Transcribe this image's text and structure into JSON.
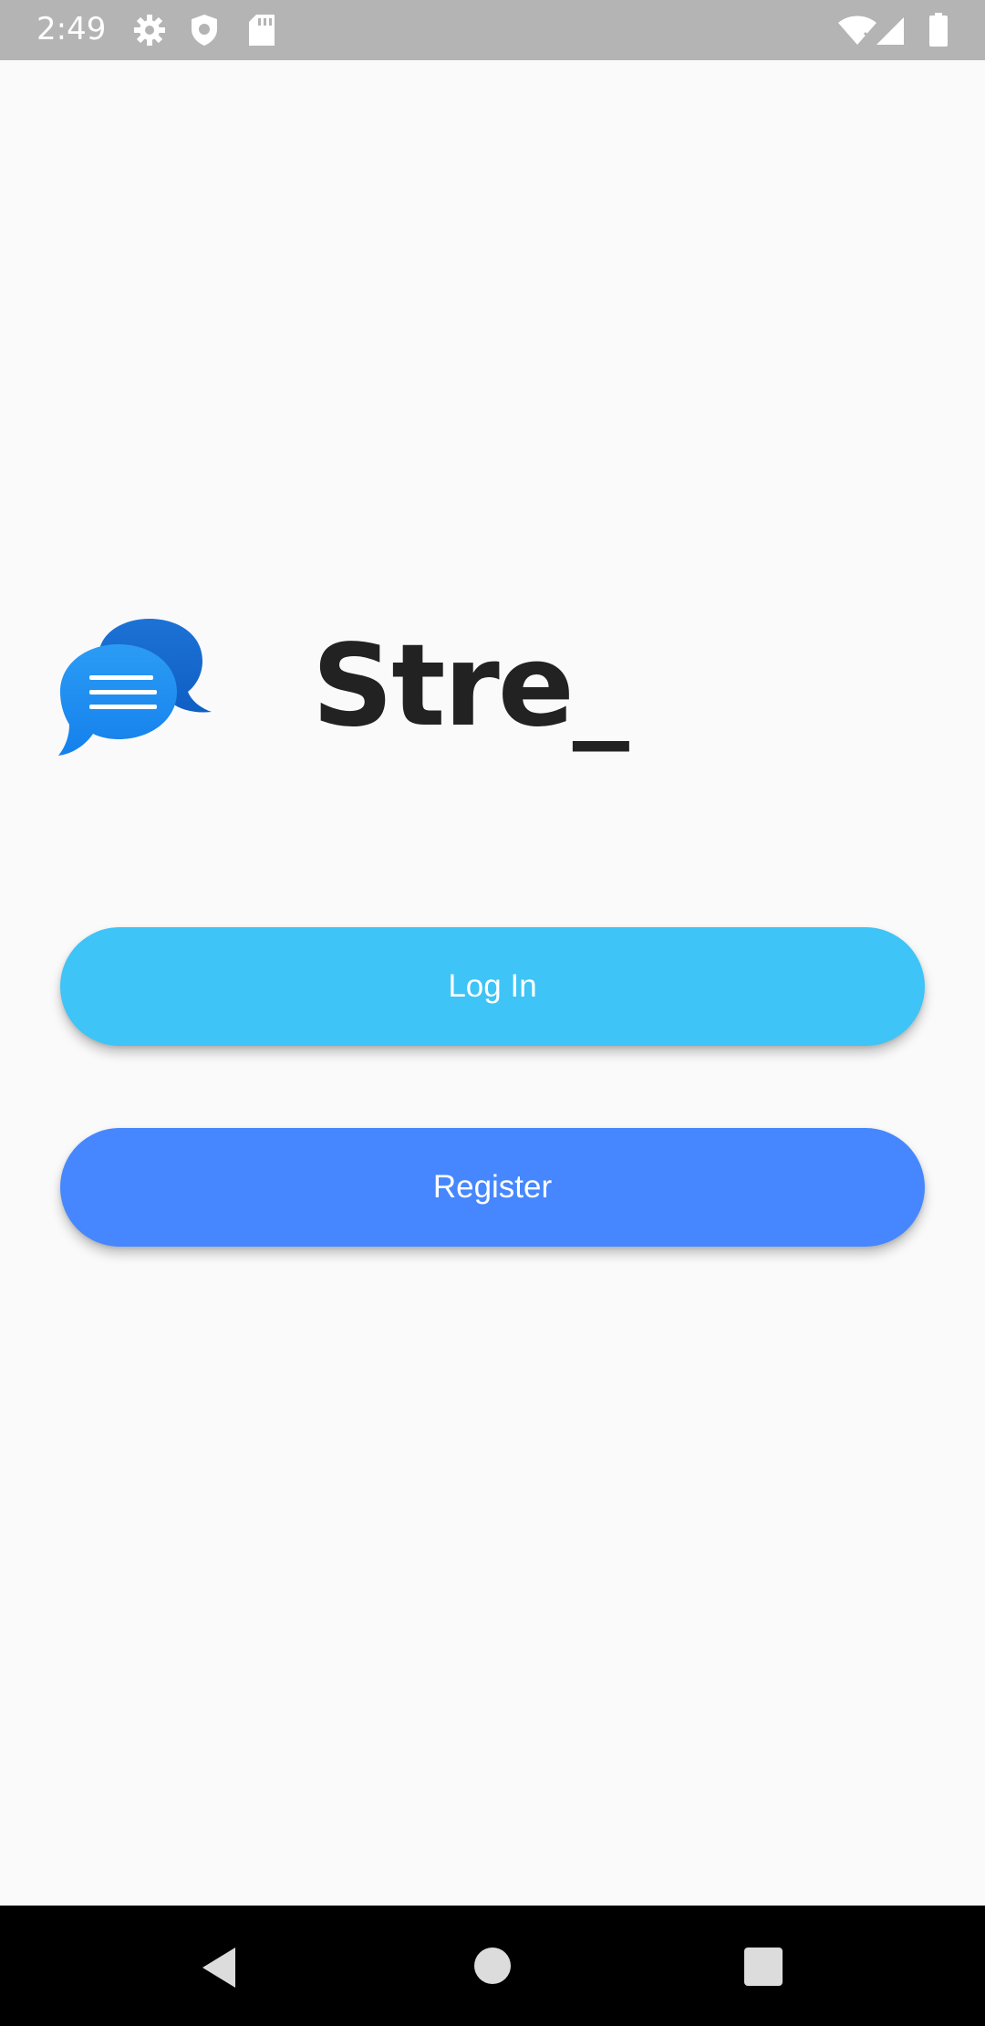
{
  "status_bar": {
    "time": "2:49",
    "icons": [
      "settings-icon",
      "shield-icon",
      "sd-card-icon",
      "wifi-icon",
      "signal-icon",
      "battery-icon"
    ]
  },
  "app": {
    "brand_name": "Stre_",
    "logo": "chat-bubbles-icon",
    "login_label": "Log In",
    "register_label": "Register"
  },
  "colors": {
    "login_button": "#3ec4f6",
    "register_button": "#4687ff",
    "logo_blue": "#1a8cf2",
    "background": "#fafafa"
  },
  "nav_bar": {
    "icons": [
      "back-icon",
      "home-icon",
      "recents-icon"
    ]
  }
}
